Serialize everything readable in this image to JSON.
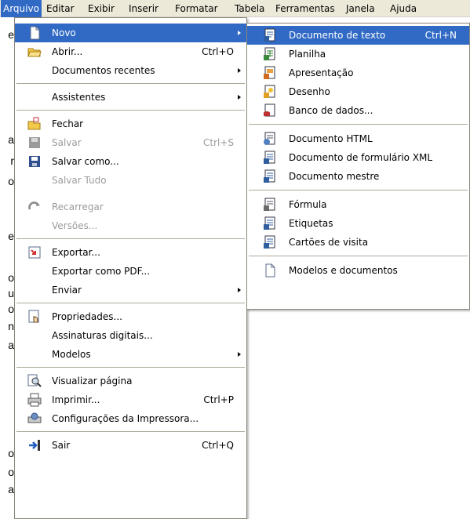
{
  "menubar": {
    "items": [
      {
        "label": "Arquivo"
      },
      {
        "label": "Editar"
      },
      {
        "label": "Exibir"
      },
      {
        "label": "Inserir"
      },
      {
        "label": "Formatar"
      },
      {
        "label": "Tabela"
      },
      {
        "label": "Ferramentas"
      },
      {
        "label": "Janela"
      },
      {
        "label": "Ajuda"
      }
    ]
  },
  "file_menu": {
    "items": [
      {
        "label": "Novo",
        "shortcut": "",
        "icon": "new-document-icon"
      },
      {
        "label": "Abrir...",
        "shortcut": "Ctrl+O",
        "icon": "open-folder-icon"
      },
      {
        "label": "Documentos recentes",
        "shortcut": ""
      },
      {
        "label": "Assistentes",
        "shortcut": ""
      },
      {
        "label": "Fechar",
        "shortcut": "",
        "icon": "close-document-icon"
      },
      {
        "label": "Salvar",
        "shortcut": "Ctrl+S",
        "icon": "save-icon"
      },
      {
        "label": "Salvar como...",
        "shortcut": "",
        "icon": "save-as-icon"
      },
      {
        "label": "Salvar Tudo",
        "shortcut": ""
      },
      {
        "label": "Recarregar",
        "shortcut": "",
        "icon": "reload-icon"
      },
      {
        "label": "Versões...",
        "shortcut": ""
      },
      {
        "label": "Exportar...",
        "shortcut": "",
        "icon": "export-icon"
      },
      {
        "label": "Exportar como PDF...",
        "shortcut": ""
      },
      {
        "label": "Enviar",
        "shortcut": ""
      },
      {
        "label": "Propriedades...",
        "shortcut": "",
        "icon": "properties-icon"
      },
      {
        "label": "Assinaturas digitais...",
        "shortcut": ""
      },
      {
        "label": "Modelos",
        "shortcut": ""
      },
      {
        "label": "Visualizar página",
        "shortcut": "",
        "icon": "page-preview-icon"
      },
      {
        "label": "Imprimir...",
        "shortcut": "Ctrl+P",
        "icon": "print-icon"
      },
      {
        "label": "Configurações da Impressora...",
        "shortcut": "",
        "icon": "printer-settings-icon"
      },
      {
        "label": "Sair",
        "shortcut": "Ctrl+Q",
        "icon": "exit-icon"
      }
    ]
  },
  "new_submenu": {
    "items": [
      {
        "label": "Documento de texto",
        "shortcut": "Ctrl+N",
        "icon": "text-document-icon"
      },
      {
        "label": "Planilha",
        "shortcut": "",
        "icon": "spreadsheet-icon"
      },
      {
        "label": "Apresentação",
        "shortcut": "",
        "icon": "presentation-icon"
      },
      {
        "label": "Desenho",
        "shortcut": "",
        "icon": "drawing-icon"
      },
      {
        "label": "Banco de dados...",
        "shortcut": "",
        "icon": "database-icon"
      },
      {
        "label": "Documento HTML",
        "shortcut": "",
        "icon": "html-document-icon"
      },
      {
        "label": "Documento de formulário XML",
        "shortcut": "",
        "icon": "xml-form-icon"
      },
      {
        "label": "Documento mestre",
        "shortcut": "",
        "icon": "master-document-icon"
      },
      {
        "label": "Fórmula",
        "shortcut": "",
        "icon": "formula-icon"
      },
      {
        "label": "Etiquetas",
        "shortcut": "",
        "icon": "labels-icon"
      },
      {
        "label": "Cartões de visita",
        "shortcut": "",
        "icon": "business-cards-icon"
      },
      {
        "label": "Modelos e documentos",
        "shortcut": "",
        "icon": "templates-icon"
      }
    ]
  },
  "background_doc": {
    "chars": [
      "e",
      "a",
      "r",
      "o",
      "e",
      "o",
      "u",
      "o",
      "n",
      "a",
      "o",
      "o",
      "a"
    ]
  },
  "colors": {
    "highlight": "#316ac5",
    "menubar_bg": "#ece9d8",
    "disabled_text": "#9b9b9b"
  }
}
